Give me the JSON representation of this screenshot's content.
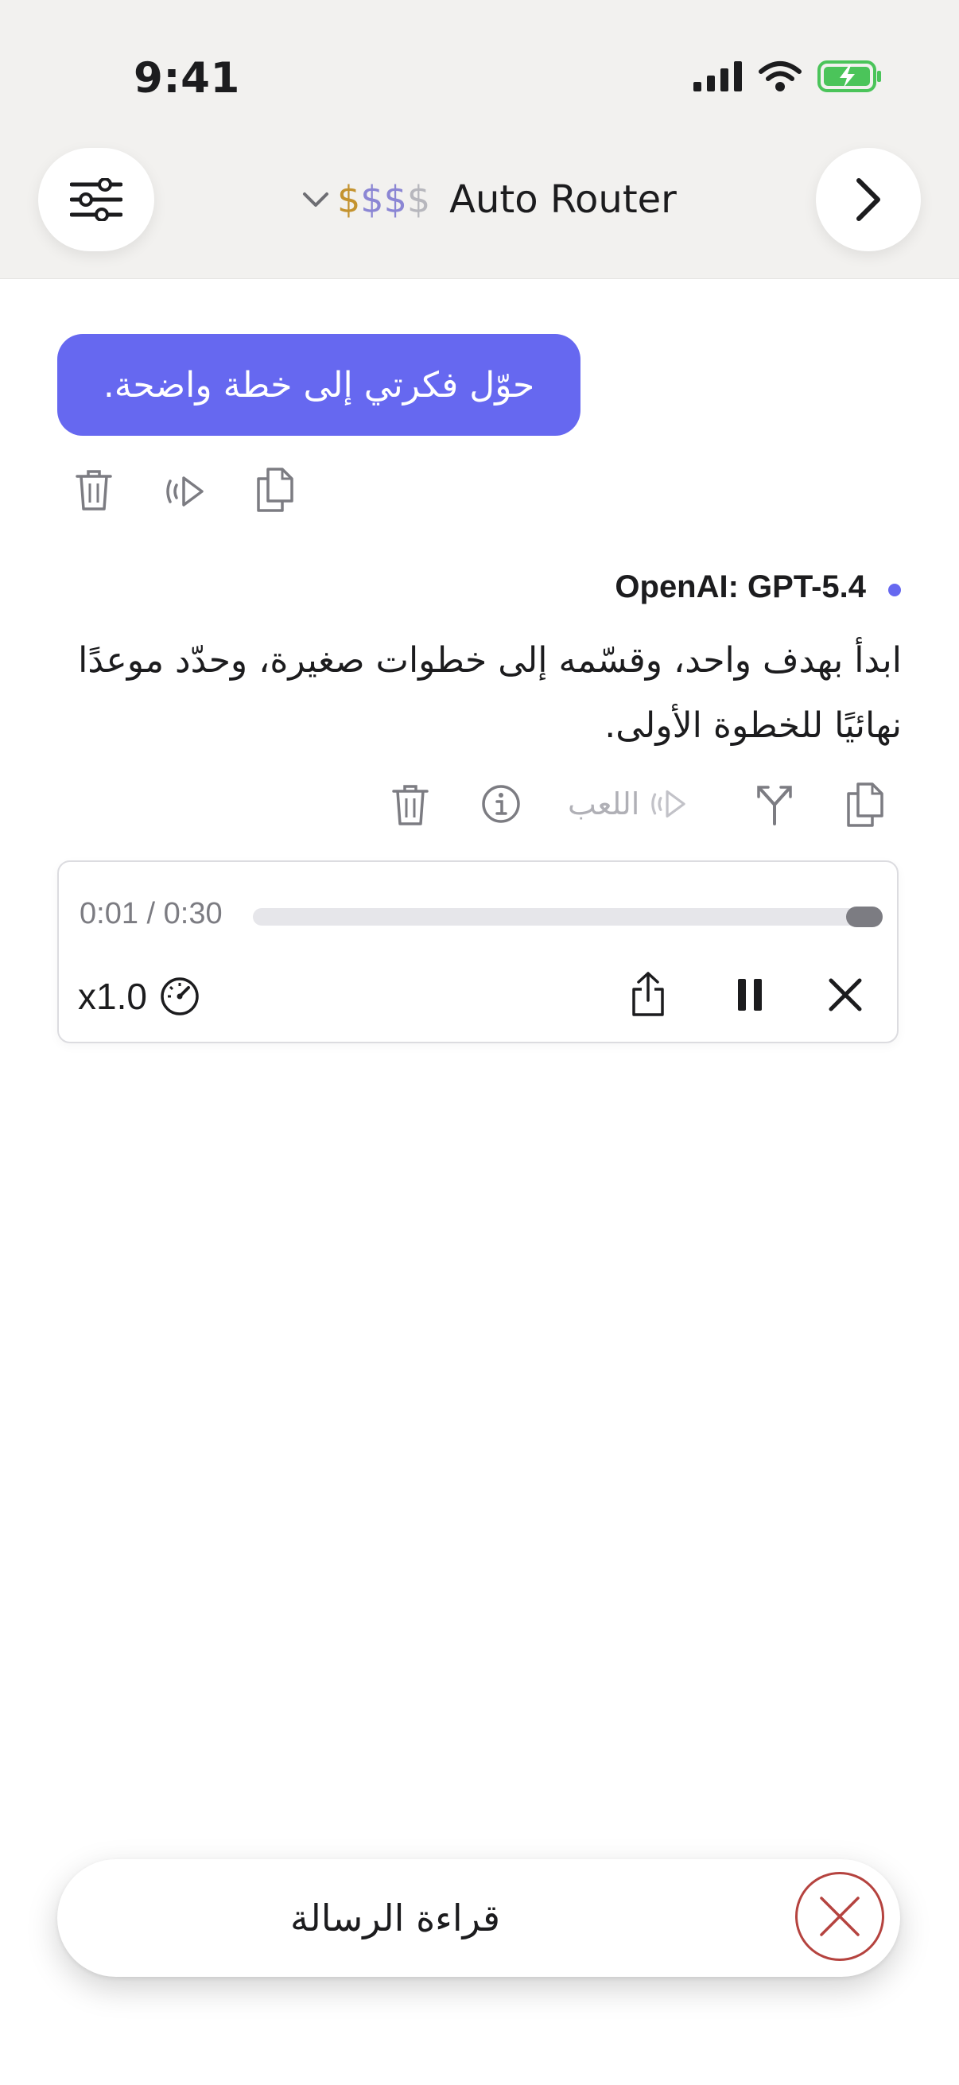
{
  "status_bar": {
    "time": "9:41"
  },
  "header": {
    "model_selector": {
      "dollar_signs": [
        {
          "char": "$",
          "color": "#c4932f"
        },
        {
          "char": "$",
          "color": "#8b86d4"
        },
        {
          "char": "$",
          "color": "#8b86d4"
        },
        {
          "char": "$",
          "color": "#b7b7bd"
        }
      ],
      "name": "Auto Router"
    }
  },
  "chat": {
    "user_message": "حوّل فكرتي إلى خطة واضحة.",
    "assistant": {
      "model": "OpenAI: GPT-5.4",
      "message": "ابدأ بهدف واحد، وقسّمه إلى خطوات صغيرة، وحدّد موعدًا نهائيًا للخطوة الأولى.",
      "play_label": "اللعب"
    }
  },
  "audio_player": {
    "elapsed_total": "0:01 / 0:30",
    "progress": 0.033,
    "speed": "x1.0"
  },
  "toast": {
    "label": "قراءة الرسالة"
  },
  "colors": {
    "accent": "#6668f0",
    "danger": "#b5433f"
  }
}
